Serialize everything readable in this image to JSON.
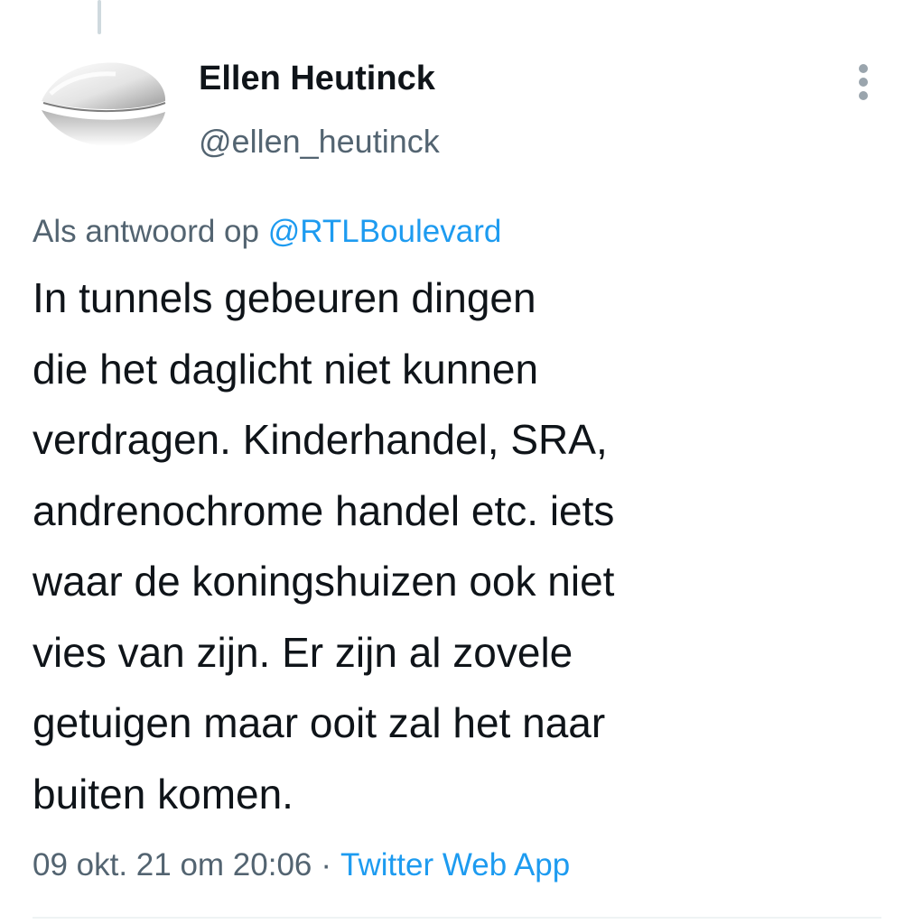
{
  "tweet": {
    "author": {
      "display_name": "Ellen Heutinck",
      "handle": "@ellen_heutinck"
    },
    "reply_context": {
      "prefix": "Als antwoord op",
      "mention": "@RTLBoulevard"
    },
    "text_lines": [
      "In tunnels gebeuren dingen",
      "die het daglicht niet kunnen",
      "verdragen. Kinderhandel, SRA,",
      "andrenochrome handel etc. iets",
      "waar de koningshuizen ook niet",
      "vies van zijn. Er zijn al zovele",
      "getuigen maar ooit zal het naar",
      "buiten komen."
    ],
    "timestamp": "09 okt. 21 om 20:06",
    "separator": "·",
    "source": "Twitter Web App"
  },
  "icons": {
    "more": "vertical-ellipsis-icon"
  },
  "colors": {
    "text_primary": "#0f1419",
    "text_secondary": "#536471",
    "link": "#1d9bf0",
    "divider": "#eff3f4"
  }
}
